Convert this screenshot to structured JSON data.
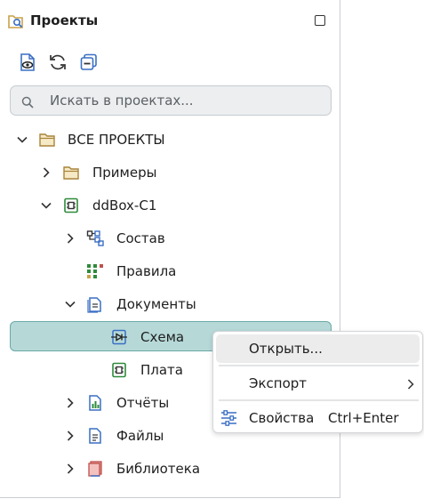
{
  "panel": {
    "title": "Проекты"
  },
  "toolbar": {
    "buttons": [
      {
        "name": "show-icon"
      },
      {
        "name": "refresh-icon"
      },
      {
        "name": "collapse-all-icon"
      }
    ]
  },
  "search": {
    "placeholder": "Искать в проектах..."
  },
  "tree": {
    "all_projects": "ВСЕ ПРОЕКТЫ",
    "examples": "Примеры",
    "project": "ddBox-C1",
    "composition": "Состав",
    "rules": "Правила",
    "documents": "Документы",
    "schematic": "Схема",
    "board": "Плата",
    "reports": "Отчёты",
    "files": "Файлы",
    "library": "Библиотека"
  },
  "context_menu": {
    "open": "Открыть...",
    "export": "Экспорт",
    "properties": "Свойства",
    "properties_shortcut": "Ctrl+Enter"
  },
  "colors": {
    "accent_blue": "#3a6fc4",
    "folder": "#c9a24a",
    "pcb_green": "#2e8b3a",
    "selection": "#b6d9d8",
    "library_red": "#c0504d"
  }
}
